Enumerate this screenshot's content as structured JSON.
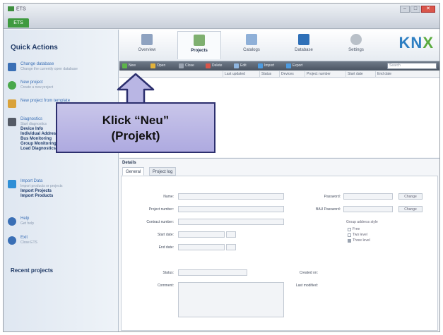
{
  "app": {
    "title": "ETS",
    "ribbon_tab": "ETS",
    "window_controls": [
      "–",
      "□",
      "✕"
    ]
  },
  "sidebar": {
    "title": "Quick Actions",
    "items": [
      {
        "label": "Change database",
        "sub": "Change the currently open database",
        "icon_color": "#3a6fb5"
      },
      {
        "label": "New project",
        "sub": "Create a new project",
        "icon_color": "#4aa84a"
      },
      {
        "label": "New project from template",
        "sub": "",
        "icon_color": "#d9a23a"
      },
      {
        "label": "Diagnostics",
        "sub": "Start diagnostics",
        "icon_color": "#555b66",
        "links": [
          "Device Info",
          "Individual Addresses",
          "Bus Monitoring",
          "Group Monitoring",
          "Load Diagnostics"
        ]
      },
      {
        "label": "Import Data",
        "sub": "Import products or projects",
        "icon_color": "#2f8fd6",
        "links": [
          "Import Projects",
          "Import Products"
        ]
      },
      {
        "label": "Help",
        "sub": "Get help",
        "icon_color": "#3a6fb5"
      },
      {
        "label": "Exit",
        "sub": "Close ETS",
        "icon_color": "#3a6fb5"
      }
    ],
    "recent_title": "Recent projects"
  },
  "topnav": {
    "tabs": [
      {
        "label": "Overview",
        "icon": "overview-icon",
        "color": "#8ea2c0"
      },
      {
        "label": "Projects",
        "icon": "projects-icon",
        "color": "#7fb070",
        "active": true
      },
      {
        "label": "Catalogs",
        "icon": "catalogs-icon",
        "color": "#8fb0d8"
      },
      {
        "label": "Database",
        "icon": "database-icon",
        "color": "#2f70b8"
      },
      {
        "label": "Settings",
        "icon": "settings-icon",
        "color": "#b9c0c8"
      }
    ],
    "logo": {
      "k": "KN",
      "x": "X"
    }
  },
  "toolbar": {
    "items": [
      {
        "label": "New",
        "color": "#5db44a"
      },
      {
        "label": "Open",
        "color": "#e2b23a"
      },
      {
        "label": "Close",
        "color": "#9aa3b0"
      },
      {
        "label": "Delete",
        "color": "#d9554a"
      },
      {
        "label": "Edit",
        "color": "#8fb6e0"
      },
      {
        "label": "Import",
        "color": "#4d9be0"
      },
      {
        "label": "Export",
        "color": "#4d9be0"
      }
    ],
    "search_placeholder": "Search"
  },
  "columns": [
    "Last updated",
    "Status",
    "Devices",
    "Project number",
    "Start date",
    "End date"
  ],
  "details": {
    "title": "Details",
    "tabs": [
      "General",
      "Project log"
    ],
    "left_fields": [
      "Name:",
      "Project number:",
      "Contract number:",
      "Start date:",
      "End date:"
    ],
    "right_fields": [
      "Password:",
      "BAU Password:"
    ],
    "change_button": "Change",
    "group_style_title": "Group address style",
    "group_style_options": [
      {
        "label": "Free",
        "checked": false
      },
      {
        "label": "Two level",
        "checked": false
      },
      {
        "label": "Three level",
        "checked": true
      }
    ],
    "status_label": "Status:",
    "comment_label": "Comment:",
    "created_label": "Created on:",
    "modified_label": "Last modified:"
  },
  "callout": {
    "line1": "Klick “Neu”",
    "line2": "(Projekt)"
  }
}
